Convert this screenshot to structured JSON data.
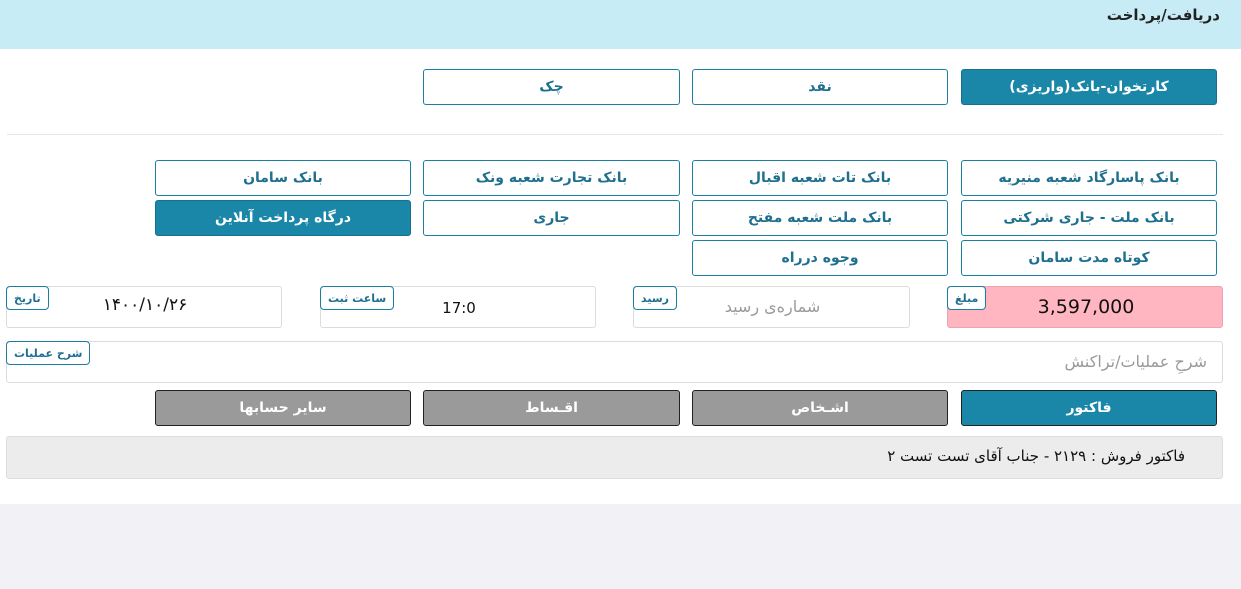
{
  "window": {
    "title": "دریافت/پرداخت"
  },
  "payment_types": [
    {
      "label": "کارتخوان-بانک(واریزی)",
      "active": true
    },
    {
      "label": "نقد",
      "active": false
    },
    {
      "label": "چک",
      "active": false
    }
  ],
  "accounts": [
    {
      "label": "بانک پاسارگاد شعبه منیریه",
      "active": false
    },
    {
      "label": "بانک تات شعبه اقبال",
      "active": false
    },
    {
      "label": "بانک تجارت شعبه ونک",
      "active": false
    },
    {
      "label": "بانک سامان",
      "active": false
    },
    {
      "label": "بانک ملت - جاری شرکتی",
      "active": false
    },
    {
      "label": "بانک ملت شعبه مفتح",
      "active": false
    },
    {
      "label": "جاری",
      "active": false
    },
    {
      "label": "درگاه پرداخت آنلاین",
      "active": true
    },
    {
      "label": "کوتاه مدت سامان",
      "active": false
    },
    {
      "label": "وجوه درراه",
      "active": false
    }
  ],
  "fields": {
    "amount": {
      "label": "مبلغ",
      "value": "3,597,000"
    },
    "receipt": {
      "label": "رسید",
      "placeholder": "شماره‌ی رسید"
    },
    "time": {
      "label": "ساعت ثبت",
      "value": "17:0"
    },
    "date": {
      "label": "تاریخ",
      "value": "۱۴۰۰/۱۰/۲۶"
    },
    "description": {
      "label": "شرح عملیات",
      "placeholder": "شرحِ عملیات/تراکنش"
    }
  },
  "target_tabs": [
    {
      "label": "فاکتور",
      "active": true
    },
    {
      "label": "اشـخاص",
      "active": false
    },
    {
      "label": "اقـساط",
      "active": false
    },
    {
      "label": "سایر حسابها",
      "active": false
    }
  ],
  "invoice_line": "فاکتور فروش : ۲۱۲۹ - جناب آقای تست تست ۲",
  "colors": {
    "header_bg": "#c8ecf5",
    "accent": "#1a86a8",
    "amount_bg": "#ffb6c1",
    "tab_gray": "#9a9a9a"
  }
}
